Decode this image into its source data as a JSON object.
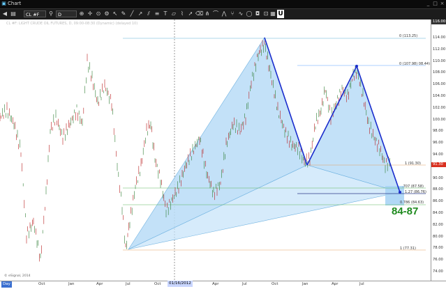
{
  "window": {
    "title": "Chart",
    "controls": [
      "_",
      "□",
      "×"
    ]
  },
  "toolbar": {
    "symbol": "CL #F",
    "interval": "D",
    "icons": [
      "add-study-icon",
      "crosshair-icon",
      "zoom-icon",
      "arrow-icon",
      "pencil-icon",
      "gear-icon",
      "cursor-icon",
      "line-icon",
      "trend-icon",
      "channel-icon",
      "fibonacci-icon",
      "text-icon",
      "shape-icon",
      "measure-icon",
      "eraser-icon",
      "magnet-icon"
    ],
    "u_label": "U"
  },
  "chart": {
    "header": "CL #F: LIGHT CRUDE OIL FUTURES, D, 09:00-08:30 (Dynamic) (delayed 10)",
    "copyright": "© eSignal, 2014",
    "target_text": "84-87",
    "date_marker": "01/16/2012",
    "bottom_left": "Day",
    "current_price": "91.30",
    "top_right_value": "116.00"
  },
  "chart_data": {
    "type": "line",
    "y_ticks": [
      "114.00",
      "112.00",
      "110.00",
      "108.00",
      "106.00",
      "104.00",
      "102.00",
      "100.00",
      "98.00",
      "96.00",
      "94.00",
      "92.00",
      "90.00",
      "88.00",
      "86.00",
      "84.00",
      "82.00",
      "80.00",
      "78.00",
      "76.00",
      "74.00"
    ],
    "x_ticks": [
      "Oct",
      "Jan",
      "Apr",
      "Jul",
      "Oct",
      "01/16/2012",
      "Apr",
      "Jul",
      "Oct",
      "Jan",
      "Apr",
      "Jul"
    ],
    "ylim": [
      73.5,
      116
    ],
    "fib_labels": {
      "f0": "0 (113.25)",
      "f0b": "0 (107.98) 08.44)",
      "f1a": "1 (91.30)",
      "f707": ".707 (87.58)",
      "f127": "1.27 (86.76)",
      "f786": "0.786 (84.63)",
      "f1b": "1 (77.31)"
    },
    "pattern": {
      "X": 77.3,
      "A": 113.3,
      "B": 91.3,
      "C": 108.0,
      "D": 87.0
    }
  }
}
